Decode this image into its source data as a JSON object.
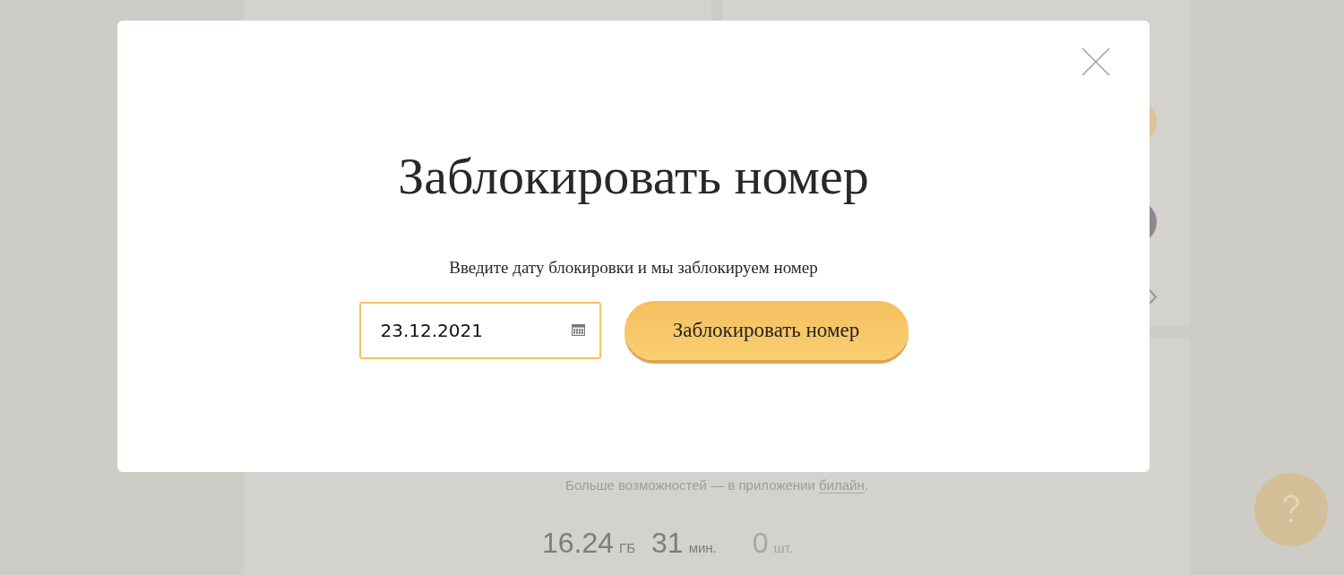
{
  "modal": {
    "title": "Заблокировать номер",
    "subtitle": "Введите дату блокировки и мы заблокируем номер",
    "date_field": {
      "value": "23.12.2021"
    },
    "submit_button": "Заблокировать номер"
  },
  "background": {
    "promo": {
      "text": "Больше возможностей — в приложении ",
      "link": "билайн",
      "end": "."
    },
    "stats": [
      {
        "value": "16.24",
        "unit": "ГБ",
        "dimmed": false
      },
      {
        "value": "31",
        "unit": "мин.",
        "dimmed": false
      },
      {
        "value": "0",
        "unit": "шт.",
        "dimmed": true
      }
    ]
  }
}
